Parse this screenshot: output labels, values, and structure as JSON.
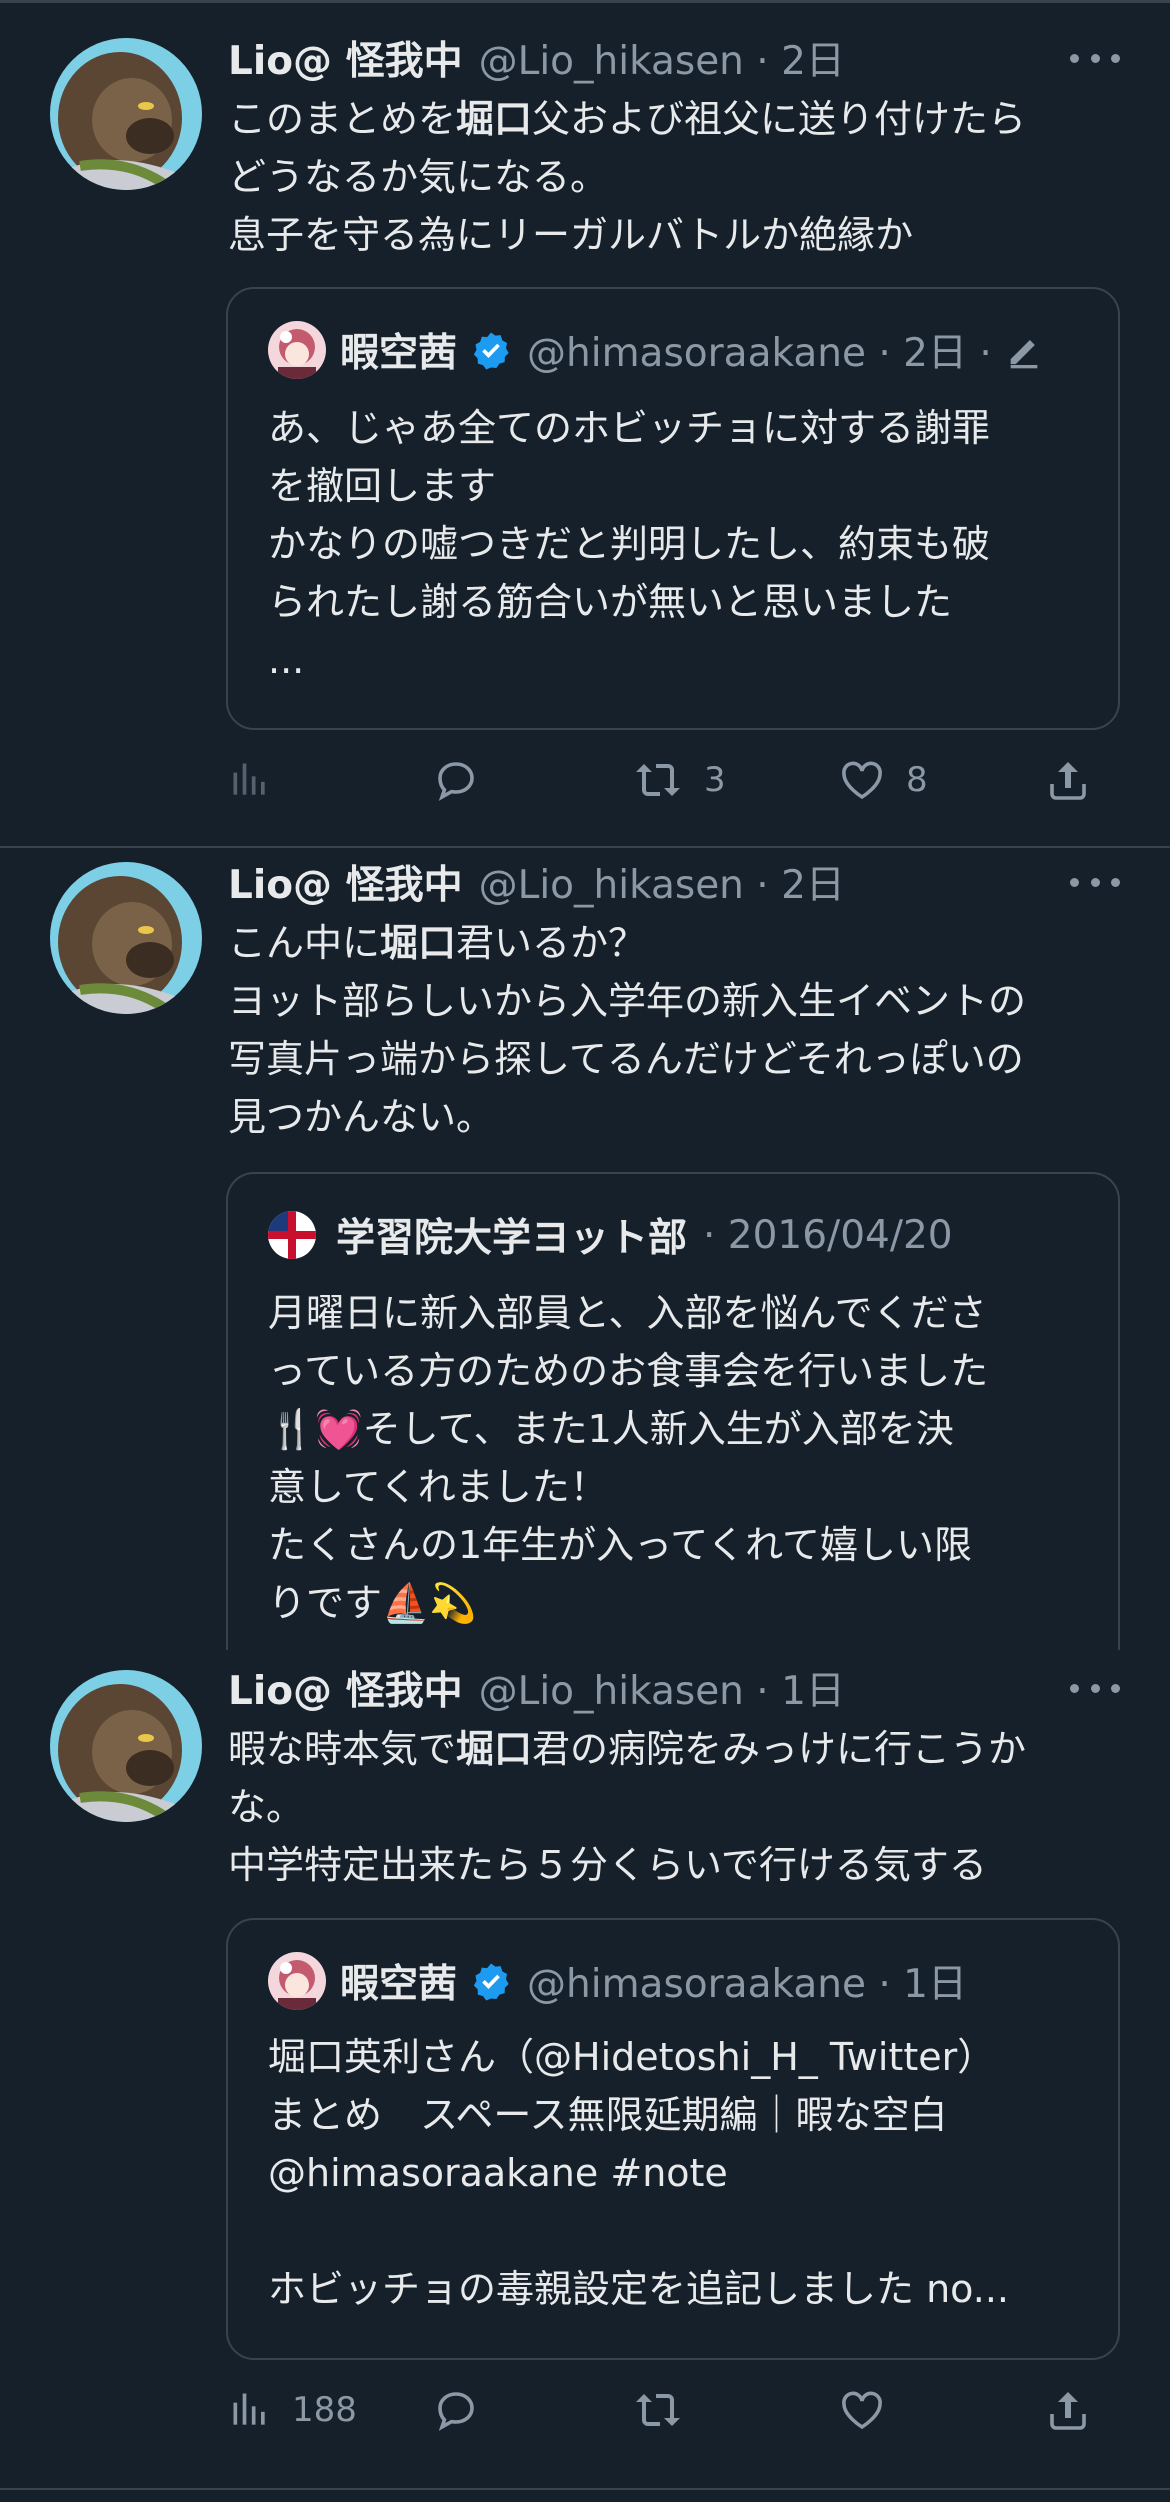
{
  "colors": {
    "background": "#15202b",
    "text": "#e7e9ea",
    "muted": "#8b98a5",
    "border": "#38444d",
    "verified": "#1d9bf0",
    "heart": "#f91880"
  },
  "tweets": [
    {
      "name": "Lio@ 怪我中",
      "handle": "@Lio_hikasen · 2日",
      "lines": [
        [
          "このまとめを",
          "堀口",
          "父および祖父に送り付けたら"
        ],
        [
          "どうなるか気になる。"
        ],
        [
          "息子を守る為にリーガルバトルか絶縁か"
        ]
      ],
      "quote": {
        "name": "暇空茜",
        "handle": "@himasoraakane · 2日 ·",
        "icon": "edit-icon",
        "lines": [
          "あ、じゃあ全てのホビッチョに対する謝罪",
          "を撤回します",
          "かなりの嘘つきだと判明したし、約束も破",
          "られたし謝る筋合いが無いと思いました",
          "..."
        ]
      },
      "actions": {
        "views": "",
        "replies": "",
        "retweets": "3",
        "likes": "8"
      }
    },
    {
      "name": "Lio@ 怪我中",
      "handle": "@Lio_hikasen · 2日",
      "lines": [
        [
          "こん中に",
          "堀口",
          "君いるか？"
        ],
        [
          "ヨット部らしいから入学年の新入生イベントの"
        ],
        [
          "写真片っ端から探してるんだけどそれっぽいの"
        ],
        [
          "見つかんない。"
        ]
      ],
      "quote": {
        "name": "学習院大学ヨット部",
        "handle": "· 2016/04/20",
        "lines": [
          "月曜日に新入部員と、入部を悩んでくださ",
          "っている方のためのお食事会を行いました",
          "🍴💓そして、また1人新入生が入部を決",
          "意してくれました！",
          "たくさんの1年生が入ってくれて嬉しい限",
          "りです⛵💫"
        ]
      }
    },
    {
      "name": "Lio@ 怪我中",
      "handle": "@Lio_hikasen · 1日",
      "lines": [
        [
          "暇な時本気で",
          "堀口",
          "君の病院をみっけに行こうか"
        ],
        [
          "な。"
        ],
        [
          "中学特定出来たら５分くらいで行ける気する"
        ]
      ],
      "quote": {
        "name": "暇空茜",
        "handle": "@himasoraakane · 1日",
        "lines": [
          "堀口英利さん（@Hidetoshi_H_ Twitter）",
          "まとめ　スペース無限延期編｜暇な空白",
          "@himasoraakane #note",
          "",
          "ホビッチョの毒親設定を追記しました no..."
        ]
      },
      "actions": {
        "views": "188",
        "replies": "",
        "retweets": "",
        "likes": ""
      }
    }
  ]
}
